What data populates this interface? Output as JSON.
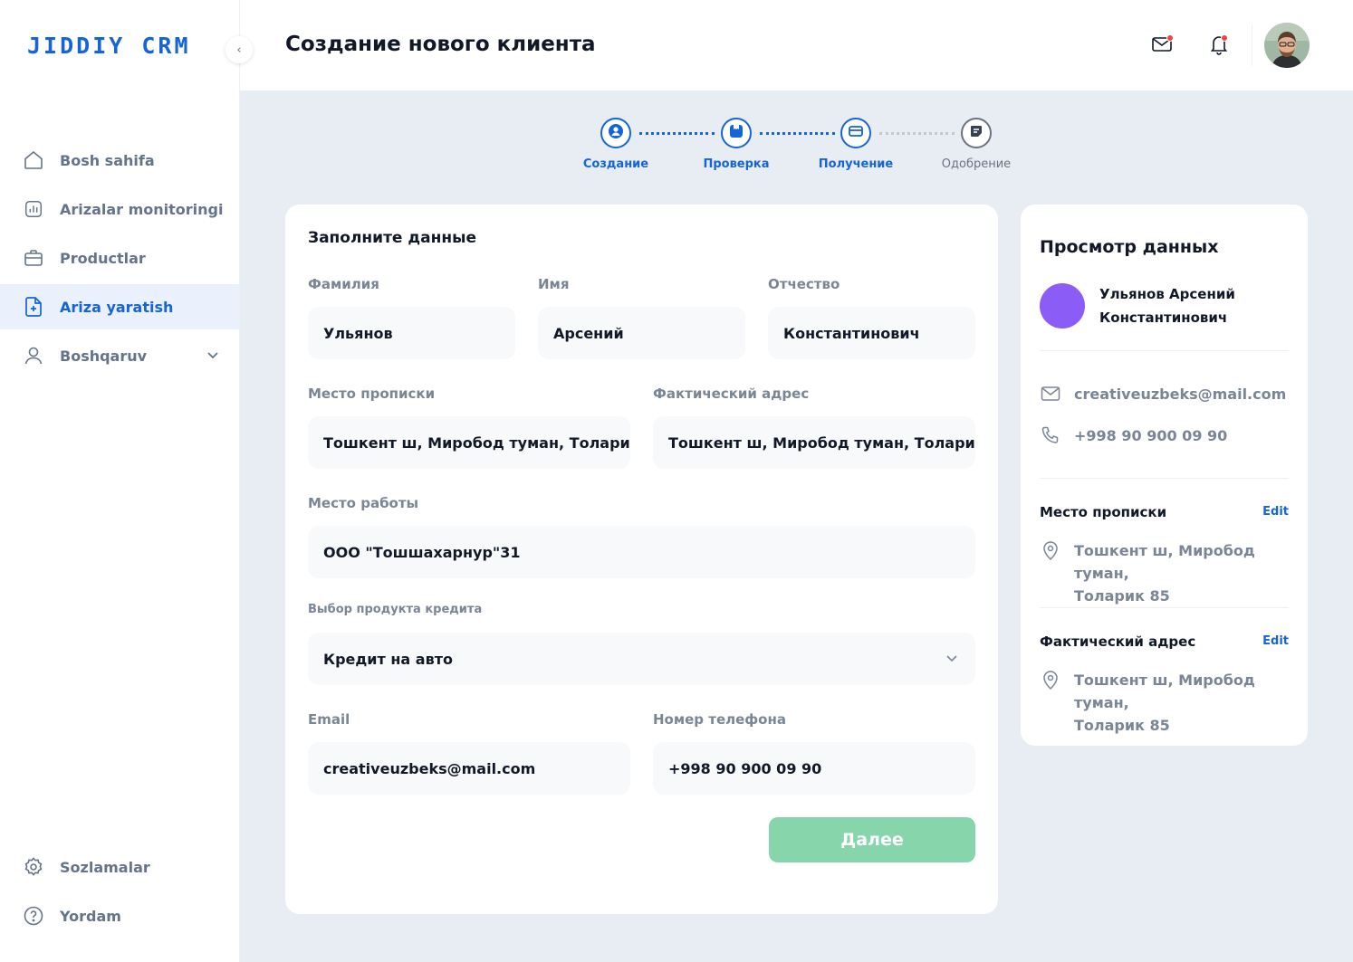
{
  "app": {
    "logo": "JIDDIY CRM"
  },
  "sidebar": {
    "items": [
      {
        "label": "Bosh sahifa",
        "icon": "home-icon"
      },
      {
        "label": "Arizalar monitoringi",
        "icon": "chart-icon"
      },
      {
        "label": "Productlar",
        "icon": "briefcase-icon"
      },
      {
        "label": "Ariza yaratish",
        "icon": "document-add-icon",
        "active": true
      },
      {
        "label": "Boshqaruv",
        "icon": "user-icon"
      }
    ],
    "bottom": [
      {
        "label": "Sozlamalar",
        "icon": "gear-icon"
      },
      {
        "label": "Yordam",
        "icon": "help-icon"
      }
    ]
  },
  "header": {
    "title": "Создание нового клиента"
  },
  "stepper": [
    {
      "label": "Создание",
      "state": "done",
      "icon": "user-icon"
    },
    {
      "label": "Проверка",
      "state": "done",
      "icon": "box-icon"
    },
    {
      "label": "Получение",
      "state": "done",
      "icon": "card-icon"
    },
    {
      "label": "Одобрение",
      "state": "pending",
      "icon": "note-icon"
    }
  ],
  "form": {
    "title": "Заполните данные",
    "last_name": {
      "label": "Фамилия",
      "value": "Ульянов"
    },
    "first_name": {
      "label": "Имя",
      "value": "Арсений"
    },
    "patronymic": {
      "label": "Отчество",
      "value": "Константинович"
    },
    "registration_address": {
      "label": "Место прописки",
      "value": "Тошкент ш, Миробод туман, Толари..."
    },
    "actual_address": {
      "label": "Фактический адрес",
      "value": "Тошкент ш, Миробод туман, Толари..."
    },
    "workplace": {
      "label": "Место работы",
      "value": "ООО \"Тошшахарнур\"31"
    },
    "credit_product": {
      "label": "Выбор продукта кредита",
      "value": "Кредит на авто"
    },
    "email": {
      "label": "Email",
      "value": "creativeuzbeks@mail.com"
    },
    "phone": {
      "label": "Номер телефона",
      "value": "+998 90 900 09 90"
    },
    "next_button": "Далее"
  },
  "preview": {
    "title": "Просмотр данных",
    "name_line1": "Ульянов Арсений",
    "name_line2": "Константинович",
    "email": "creativeuzbeks@mail.com",
    "phone": "+998 90 900 09 90",
    "registration": {
      "label": "Место прописки",
      "edit": "Edit",
      "line1": "Тошкент ш, Миробод туман,",
      "line2": "Толарик 85"
    },
    "actual": {
      "label": "Фактический адрес",
      "edit": "Edit",
      "line1": "Тошкент ш, Миробод туман,",
      "line2": "Толарик 85"
    }
  },
  "colors": {
    "accent": "#1565d8",
    "button": "#86d5ab",
    "avatar": "#8b5cf6",
    "background": "#e8edf4"
  }
}
